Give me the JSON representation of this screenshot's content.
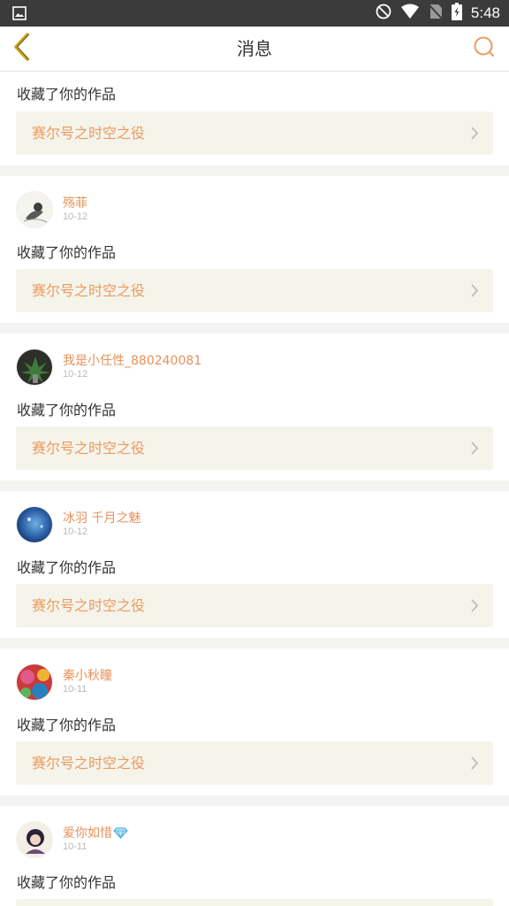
{
  "status": {
    "time": "5:48"
  },
  "header": {
    "title": "消息"
  },
  "action_text": "收藏了你的作品",
  "work_title": "赛尔号之时空之役",
  "items": [
    {
      "name": "殇菲",
      "date": "10-12"
    },
    {
      "name": "我是小任性_880240081",
      "date": "10-12"
    },
    {
      "name": "冰羽 千月之魅",
      "date": "10-12"
    },
    {
      "name": "秦小秋瞳",
      "date": "10-11"
    },
    {
      "name": "爱你如惜",
      "date": "10-11"
    }
  ],
  "colors": {
    "accent": "#e8915a",
    "back": "#c9a21a",
    "card_work_bg": "#f5f4ea"
  },
  "icons": [
    "image-icon",
    "dnd-icon",
    "wifi-icon",
    "no-sim-icon",
    "battery-icon",
    "back-chevron-icon",
    "search-icon",
    "chevron-right-icon",
    "diamond-icon"
  ]
}
